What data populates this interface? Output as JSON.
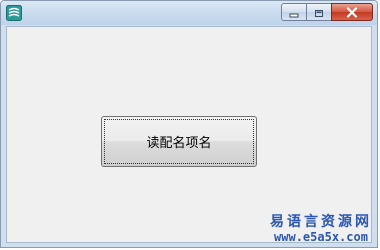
{
  "window": {
    "title": "",
    "caption_buttons": [
      "minimize-button",
      "maximize-button",
      "close-button"
    ]
  },
  "main_button": {
    "label": "读配名项名"
  },
  "watermark": {
    "line1": "易语言资源网",
    "line2": "www.e5a5x.com"
  },
  "colors": {
    "titlebar": "#c9daee",
    "client_bg": "#f0f0f0",
    "close_red": "#c23a22",
    "watermark_blue": "#2a57b5"
  },
  "icons": [
    "app-icon",
    "minimize-icon",
    "maximize-icon",
    "close-icon"
  ]
}
